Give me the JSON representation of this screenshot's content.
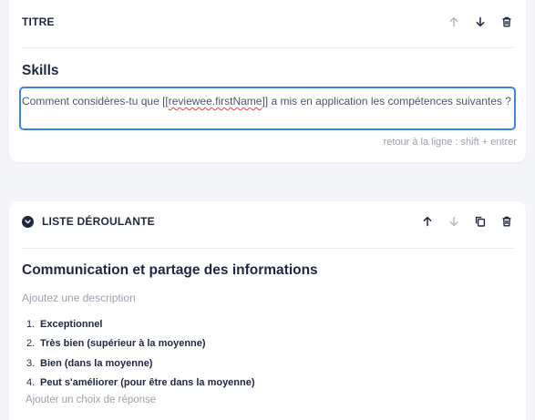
{
  "blocks": [
    {
      "type_label": "TITRE",
      "title": "Skills",
      "question_parts": {
        "before": "Comment considères-tu que [[",
        "variable": "reviewee.firstName",
        "after": "]] a mis en application les compétences suivantes ?"
      },
      "hint": "retour à la ligne : shift + entrer",
      "actions": [
        "arrow-up-icon",
        "arrow-down-icon",
        "trash-icon"
      ]
    },
    {
      "type_label": "LISTE DÉROULANTE",
      "title": "Communication et partage des informations",
      "description_placeholder": "Ajoutez une description",
      "choices": [
        {
          "number": "1.",
          "label": "Exceptionnel"
        },
        {
          "number": "2.",
          "label": "Très bien (supérieur à la moyenne)"
        },
        {
          "number": "3.",
          "label": "Bien (dans la moyenne)"
        },
        {
          "number": "4.",
          "label": "Peut s'améliorer (pour être dans la moyenne)"
        }
      ],
      "add_choice_label": "Ajouter un choix de réponse",
      "actions": [
        "arrow-up-icon",
        "arrow-down-icon",
        "copy-icon",
        "trash-icon"
      ]
    }
  ],
  "colors": {
    "accent": "#3e86d6",
    "text": "#1f2742",
    "muted": "#9aa1b0",
    "icon_active": "#1f2742",
    "icon_disabled": "#b3b8c4"
  }
}
